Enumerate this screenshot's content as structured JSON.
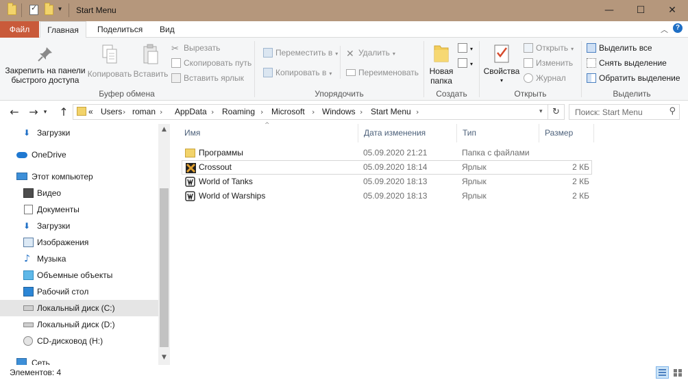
{
  "window": {
    "title": "Start Menu",
    "minimize": "—",
    "maximize": "☐",
    "close": "✕"
  },
  "ribbon_tabs": [
    {
      "label": "Файл"
    },
    {
      "label": "Главная"
    },
    {
      "label": "Поделиться"
    },
    {
      "label": "Вид"
    }
  ],
  "ribbon_controls": {
    "collapse": "︿",
    "help": "?"
  },
  "ribbon": {
    "clipboard": {
      "label": "Буфер обмена",
      "pin": "Закрепить на панели быстрого доступа",
      "copy": "Копировать",
      "paste": "Вставить",
      "cut": "Вырезать",
      "copy_path": "Скопировать путь",
      "paste_shortcut": "Вставить ярлык"
    },
    "organize": {
      "label": "Упорядочить",
      "move_to": "Переместить в",
      "copy_to": "Копировать в",
      "delete": "Удалить",
      "rename": "Переименовать"
    },
    "create": {
      "label": "Создать",
      "new_folder": "Новая папка"
    },
    "open": {
      "label": "Открыть",
      "properties": "Свойства",
      "open": "Открыть",
      "edit": "Изменить",
      "history": "Журнал"
    },
    "select": {
      "label": "Выделить",
      "select_all": "Выделить все",
      "select_none": "Снять выделение",
      "invert": "Обратить выделение"
    }
  },
  "address": {
    "overflow": "«",
    "crumbs": [
      "Users",
      "roman",
      "AppData",
      "Roaming",
      "Microsoft",
      "Windows",
      "Start Menu"
    ],
    "search_placeholder": "Поиск: Start Menu"
  },
  "nav_pane": {
    "items": [
      {
        "label": "Загрузки"
      },
      {
        "label": "OneDrive"
      },
      {
        "label": "Этот компьютер"
      },
      {
        "label": "Видео"
      },
      {
        "label": "Документы"
      },
      {
        "label": "Загрузки"
      },
      {
        "label": "Изображения"
      },
      {
        "label": "Музыка"
      },
      {
        "label": "Объемные объекты"
      },
      {
        "label": "Рабочий стол"
      },
      {
        "label": "Локальный диск (C:)"
      },
      {
        "label": "Локальный диск (D:)"
      },
      {
        "label": "CD-дисковод (H:)"
      },
      {
        "label": "Сеть"
      }
    ]
  },
  "file_list": {
    "columns": {
      "name": "Имя",
      "date": "Дата изменения",
      "type": "Тип",
      "size": "Размер"
    },
    "rows": [
      {
        "name": "Программы",
        "date": "05.09.2020 21:21",
        "type": "Папка с файлами",
        "size": ""
      },
      {
        "name": "Crossout",
        "date": "05.09.2020 18:14",
        "type": "Ярлык",
        "size": "2 КБ"
      },
      {
        "name": "World of Tanks",
        "date": "05.09.2020 18:13",
        "type": "Ярлык",
        "size": "2 КБ"
      },
      {
        "name": "World of Warships",
        "date": "05.09.2020 18:13",
        "type": "Ярлык",
        "size": "2 КБ"
      }
    ]
  },
  "status": {
    "item_count": "Элементов: 4"
  },
  "colors": {
    "file_tab": "#c95a3a",
    "titlebar": "#b5977c",
    "selection": "#e5e5e5",
    "accent": "#0078d7"
  }
}
